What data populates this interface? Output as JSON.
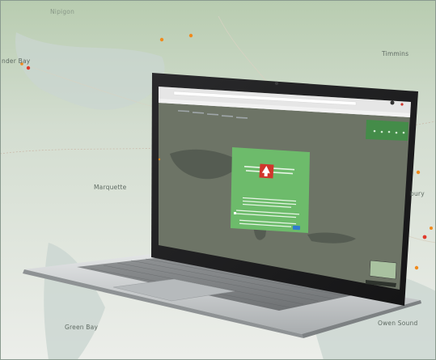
{
  "map_labels": {
    "nipigon": "Nipigon",
    "thunder_bay": "nder Bay",
    "timmins": "Timmins",
    "marquette": "Marquette",
    "sudbury": "bury",
    "green_bay": "Green Bay",
    "owen_sound": "Owen Sound"
  },
  "colors": {
    "map_background": "#e8ede7",
    "map_top_tint": "#b9cdb1",
    "water": "#cfd8d4",
    "laptop_body": "#c9cccd",
    "screen_map": "#6d7466",
    "dialog_green": "#6dbb6b",
    "logo_red": "#d0362c",
    "toolbar_green": "#3f8f46",
    "marker_orange": "#f08a1c",
    "marker_red": "#e0392b"
  },
  "icons": {
    "dialog_logo": "red-square-logo-icon",
    "map_markers": "orange-map-marker-icon"
  }
}
